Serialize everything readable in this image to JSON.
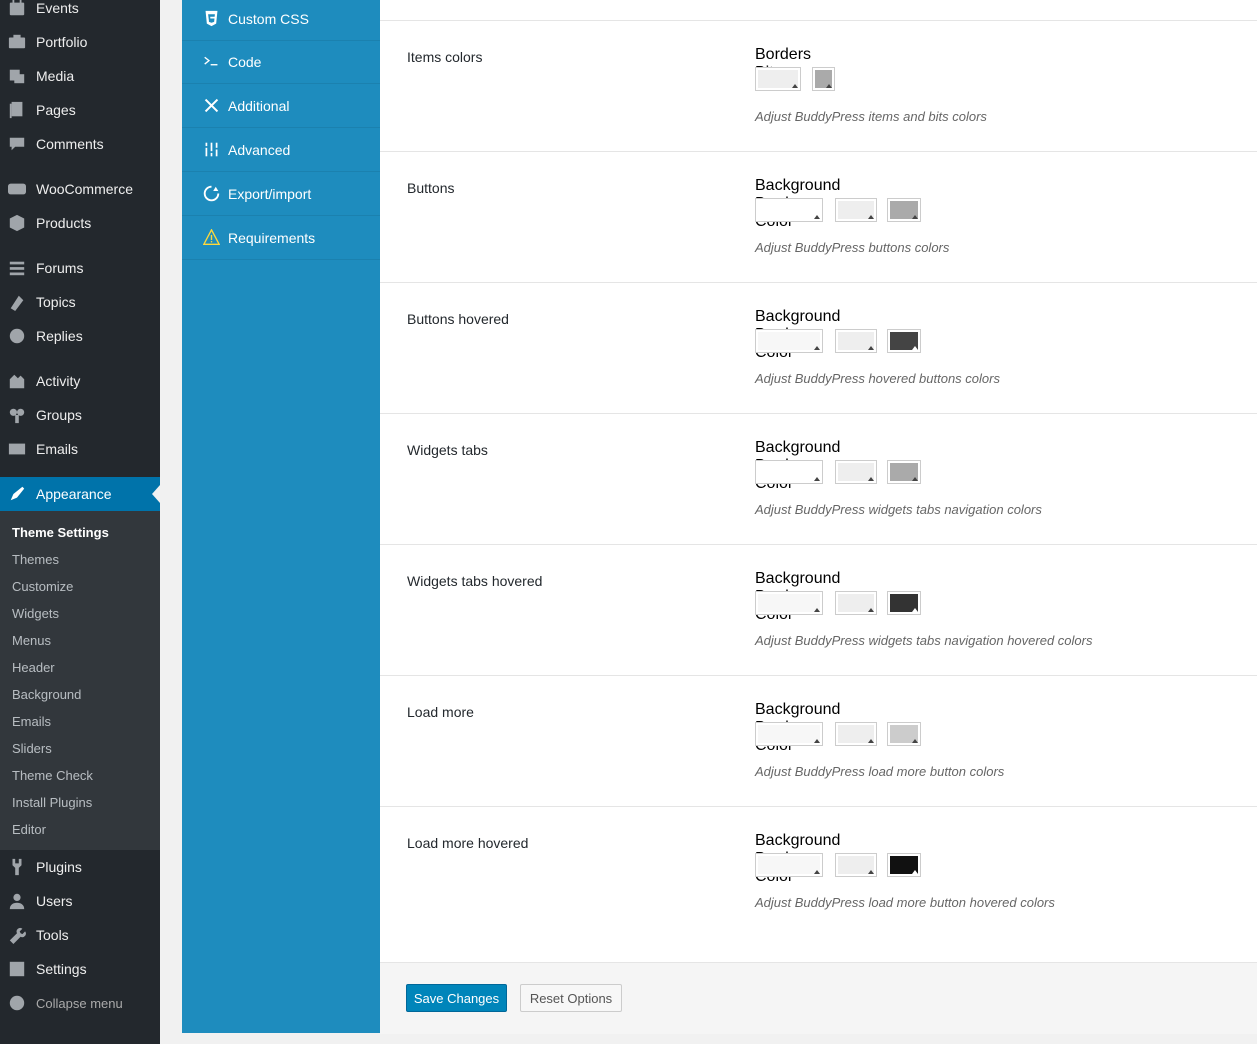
{
  "admin_menu": {
    "items": [
      {
        "label": "Events",
        "icon": "calendar-icon"
      },
      {
        "label": "Portfolio",
        "icon": "portfolio-icon"
      },
      {
        "label": "Media",
        "icon": "media-icon"
      },
      {
        "label": "Pages",
        "icon": "pages-icon"
      },
      {
        "label": "Comments",
        "icon": "comments-icon"
      },
      {
        "label": "WooCommerce",
        "icon": "woocommerce-icon"
      },
      {
        "label": "Products",
        "icon": "products-icon"
      },
      {
        "label": "Forums",
        "icon": "forums-icon"
      },
      {
        "label": "Topics",
        "icon": "topics-icon"
      },
      {
        "label": "Replies",
        "icon": "replies-icon"
      },
      {
        "label": "Activity",
        "icon": "activity-icon"
      },
      {
        "label": "Groups",
        "icon": "groups-icon"
      },
      {
        "label": "Emails",
        "icon": "emails-icon"
      },
      {
        "label": "Appearance",
        "icon": "appearance-icon",
        "current": true
      },
      {
        "label": "Plugins",
        "icon": "plugins-icon"
      },
      {
        "label": "Users",
        "icon": "users-icon"
      },
      {
        "label": "Tools",
        "icon": "tools-icon"
      },
      {
        "label": "Settings",
        "icon": "settings-icon"
      },
      {
        "label": "Collapse menu",
        "icon": "collapse-icon"
      }
    ],
    "submenu": [
      {
        "label": "Theme Settings",
        "current": true
      },
      {
        "label": "Themes"
      },
      {
        "label": "Customize"
      },
      {
        "label": "Widgets"
      },
      {
        "label": "Menus"
      },
      {
        "label": "Header"
      },
      {
        "label": "Background"
      },
      {
        "label": "Emails"
      },
      {
        "label": "Sliders"
      },
      {
        "label": "Theme Check"
      },
      {
        "label": "Install Plugins"
      },
      {
        "label": "Editor"
      }
    ]
  },
  "options_nav": [
    {
      "label": "Custom CSS",
      "icon": "css3-icon"
    },
    {
      "label": "Code",
      "icon": "terminal-icon"
    },
    {
      "label": "Additional",
      "icon": "tools-cross-icon"
    },
    {
      "label": "Advanced",
      "icon": "sliders-icon"
    },
    {
      "label": "Export/import",
      "icon": "refresh-icon"
    },
    {
      "label": "Requirements",
      "icon": "warning-icon"
    }
  ],
  "settings": [
    {
      "label": "Items colors",
      "pickers": [
        {
          "label": "Borders",
          "color": "#eeeeee"
        },
        {
          "label": "Bits",
          "color": "#aaaaaa"
        }
      ],
      "description": "Adjust BuddyPress items and bits colors"
    },
    {
      "label": "Buttons",
      "pickers": [
        {
          "label": "Background",
          "color": "#ffffff"
        },
        {
          "label": "Border",
          "color": "#eeeeee"
        },
        {
          "label": "Color",
          "color": "#aaaaaa"
        }
      ],
      "description": "Adjust BuddyPress buttons colors"
    },
    {
      "label": "Buttons hovered",
      "pickers": [
        {
          "label": "Background",
          "color": "#f7f7f7"
        },
        {
          "label": "Border",
          "color": "#eeeeee"
        },
        {
          "label": "Color",
          "color": "#444444"
        }
      ],
      "description": "Adjust BuddyPress hovered buttons colors"
    },
    {
      "label": "Widgets tabs",
      "pickers": [
        {
          "label": "Background",
          "color": "#ffffff"
        },
        {
          "label": "Border",
          "color": "#eeeeee"
        },
        {
          "label": "Color",
          "color": "#aaaaaa"
        }
      ],
      "description": "Adjust BuddyPress widgets tabs navigation colors"
    },
    {
      "label": "Widgets tabs hovered",
      "pickers": [
        {
          "label": "Background",
          "color": "#f7f7f7"
        },
        {
          "label": "Border",
          "color": "#eeeeee"
        },
        {
          "label": "Color",
          "color": "#333333"
        }
      ],
      "description": "Adjust BuddyPress widgets tabs navigation hovered colors"
    },
    {
      "label": "Load more",
      "pickers": [
        {
          "label": "Background",
          "color": "#f7f7f7"
        },
        {
          "label": "Border",
          "color": "#eeeeee"
        },
        {
          "label": "Color",
          "color": "#cccccc"
        }
      ],
      "description": "Adjust BuddyPress load more button colors"
    },
    {
      "label": "Load more hovered",
      "pickers": [
        {
          "label": "Background",
          "color": "#f7f7f7"
        },
        {
          "label": "Border",
          "color": "#eeeeee"
        },
        {
          "label": "Color",
          "color": "#111111"
        }
      ],
      "description": "Adjust BuddyPress load more button hovered colors"
    }
  ],
  "footer": {
    "save_label": "Save Changes",
    "reset_label": "Reset Options"
  },
  "colors": {
    "admin_bg": "#23282d",
    "admin_submenu_bg": "#32373c",
    "admin_current": "#0073aa",
    "options_nav_bg": "#1e8cbe",
    "primary_button": "#0085ba"
  }
}
